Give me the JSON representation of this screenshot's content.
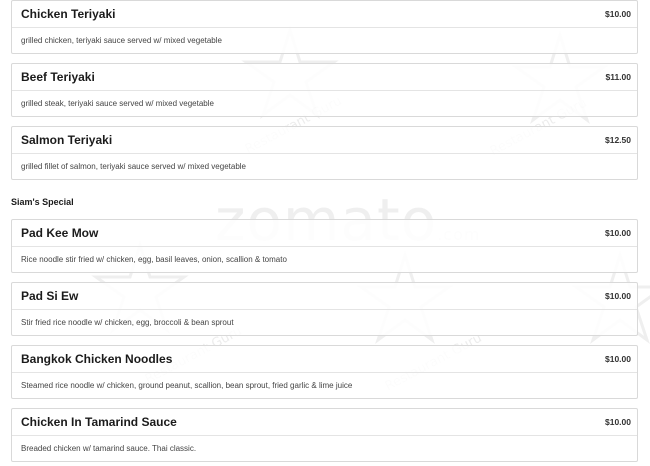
{
  "watermark": {
    "brand": "zomato",
    "domain": ".com",
    "site_label": "Restaurant Guru"
  },
  "section": {
    "title": "Siam's Special"
  },
  "items_top": [
    {
      "name": "Chicken Teriyaki",
      "price": "$10.00",
      "description": "grilled chicken, teriyaki sauce served w/ mixed vegetable"
    },
    {
      "name": "Beef Teriyaki",
      "price": "$11.00",
      "description": "grilled steak, teriyaki sauce served w/ mixed vegetable"
    },
    {
      "name": "Salmon Teriyaki",
      "price": "$12.50",
      "description": "grilled fillet of salmon, teriyaki sauce served w/ mixed vegetable"
    }
  ],
  "items_special": [
    {
      "name": "Pad Kee Mow",
      "price": "$10.00",
      "description": "Rice noodle stir fried w/ chicken, egg, basil leaves, onion, scallion & tomato"
    },
    {
      "name": "Pad Si Ew",
      "price": "$10.00",
      "description": "Stir fried rice noodle w/ chicken, egg, broccoli & bean sprout"
    },
    {
      "name": "Bangkok Chicken Noodles",
      "price": "$10.00",
      "description": "Steamed rice noodle w/ chicken, ground peanut, scallion, bean sprout, fried garlic & lime juice"
    },
    {
      "name": "Chicken In Tamarind Sauce",
      "price": "$10.00",
      "description": "Breaded chicken w/ tamarind sauce. Thai classic."
    }
  ]
}
